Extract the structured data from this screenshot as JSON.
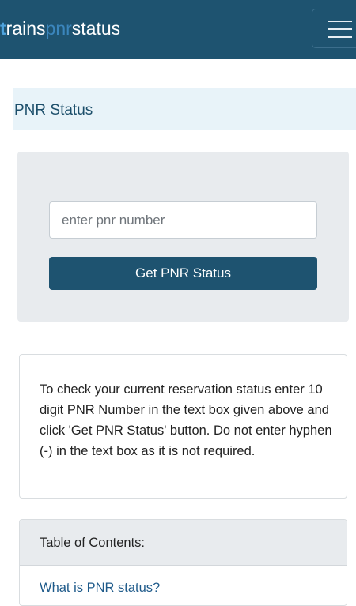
{
  "brand": {
    "part1_first": "t",
    "part1_rest": "rains",
    "part2": "pnr",
    "part3": "status"
  },
  "nav": {
    "menu_icon": "hamburger-icon"
  },
  "page": {
    "title": "PNR Status"
  },
  "form": {
    "pnr_placeholder": "enter pnr number",
    "pnr_value": "",
    "submit_label": "Get PNR Status"
  },
  "info": {
    "text": "To check your current reservation status enter 10 digit PNR Number in the text box given above and click 'Get PNR Status' button. Do not enter hyphen (-) in the text box as it is not required."
  },
  "toc": {
    "heading": "Table of Contents:",
    "items": [
      {
        "label": "What is PNR status?"
      }
    ]
  },
  "colors": {
    "navbar": "#1e5370",
    "accent": "#4fa3dd",
    "button": "#1e5370"
  }
}
